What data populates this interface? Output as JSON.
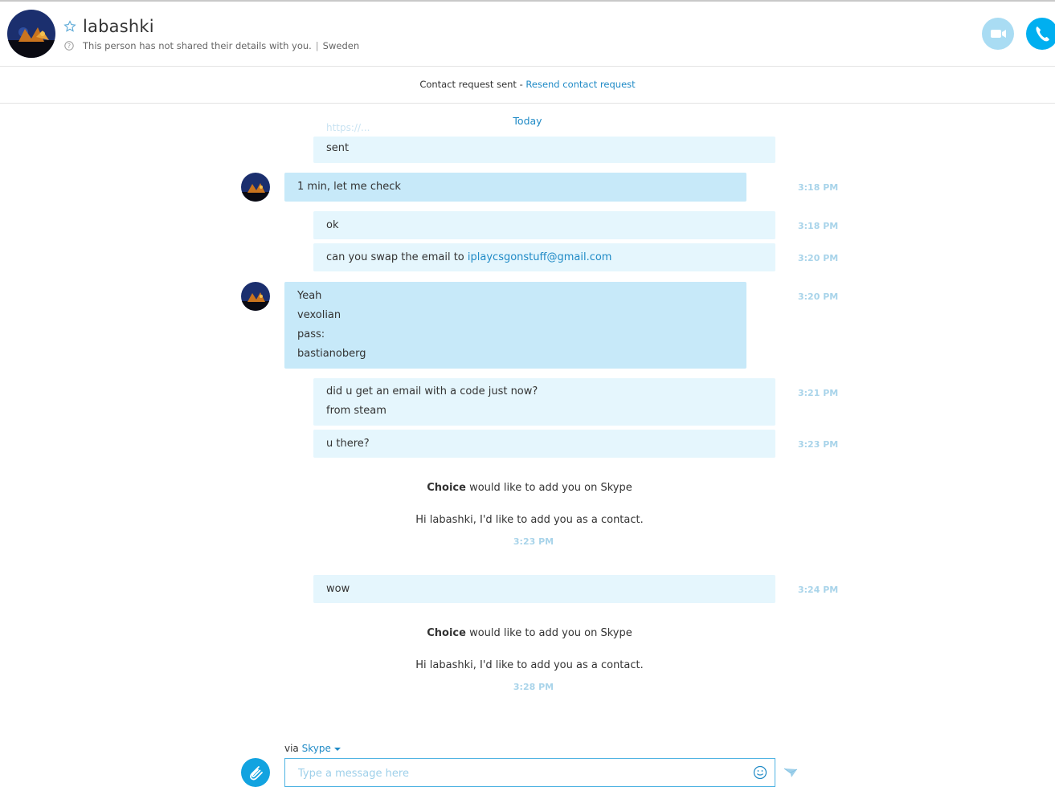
{
  "header": {
    "contact_name": "labashki",
    "status_text": "This person has not shared their details with you.",
    "location": "Sweden"
  },
  "request_bar": {
    "text": "Contact request sent - ",
    "link": "Resend contact request"
  },
  "today_label": "Today",
  "faded_text": "https://...",
  "messages": [
    {
      "lines": [
        "sent"
      ],
      "time": ""
    },
    {
      "lines": [
        "1 min, let me check"
      ],
      "time": "3:18 PM"
    },
    {
      "lines": [
        "ok"
      ],
      "time": "3:18 PM"
    },
    {
      "lines": [
        "can you swap the email to "
      ],
      "link": "iplaycsgonstuff@gmail.com",
      "time": "3:20 PM"
    },
    {
      "lines": [
        "Yeah",
        "vexolian",
        "pass:",
        "bastianoberg"
      ],
      "time": "3:20 PM"
    },
    {
      "lines": [
        "did u get an email with a code just now?",
        "from steam"
      ],
      "time": "3:21 PM"
    },
    {
      "lines": [
        "u there?"
      ],
      "time": "3:23 PM"
    },
    {
      "lines": [
        "wow"
      ],
      "time": "3:24 PM"
    }
  ],
  "system_messages": [
    {
      "name": "Choice",
      "text": " would like to add you on Skype",
      "greeting": "Hi labashki, I'd like to add you as a contact.",
      "time": "3:23 PM"
    },
    {
      "name": "Choice",
      "text": " would like to add you on Skype",
      "greeting": "Hi labashki, I'd like to add you as a contact.",
      "time": "3:28 PM"
    }
  ],
  "composer": {
    "via_label": "via ",
    "service": "Skype",
    "placeholder": "Type a message here"
  },
  "colors": {
    "accent": "#00aff0",
    "link": "#1f8ac6",
    "bubble_out": "#e5f6fd",
    "bubble_in": "#c7e9f9"
  }
}
